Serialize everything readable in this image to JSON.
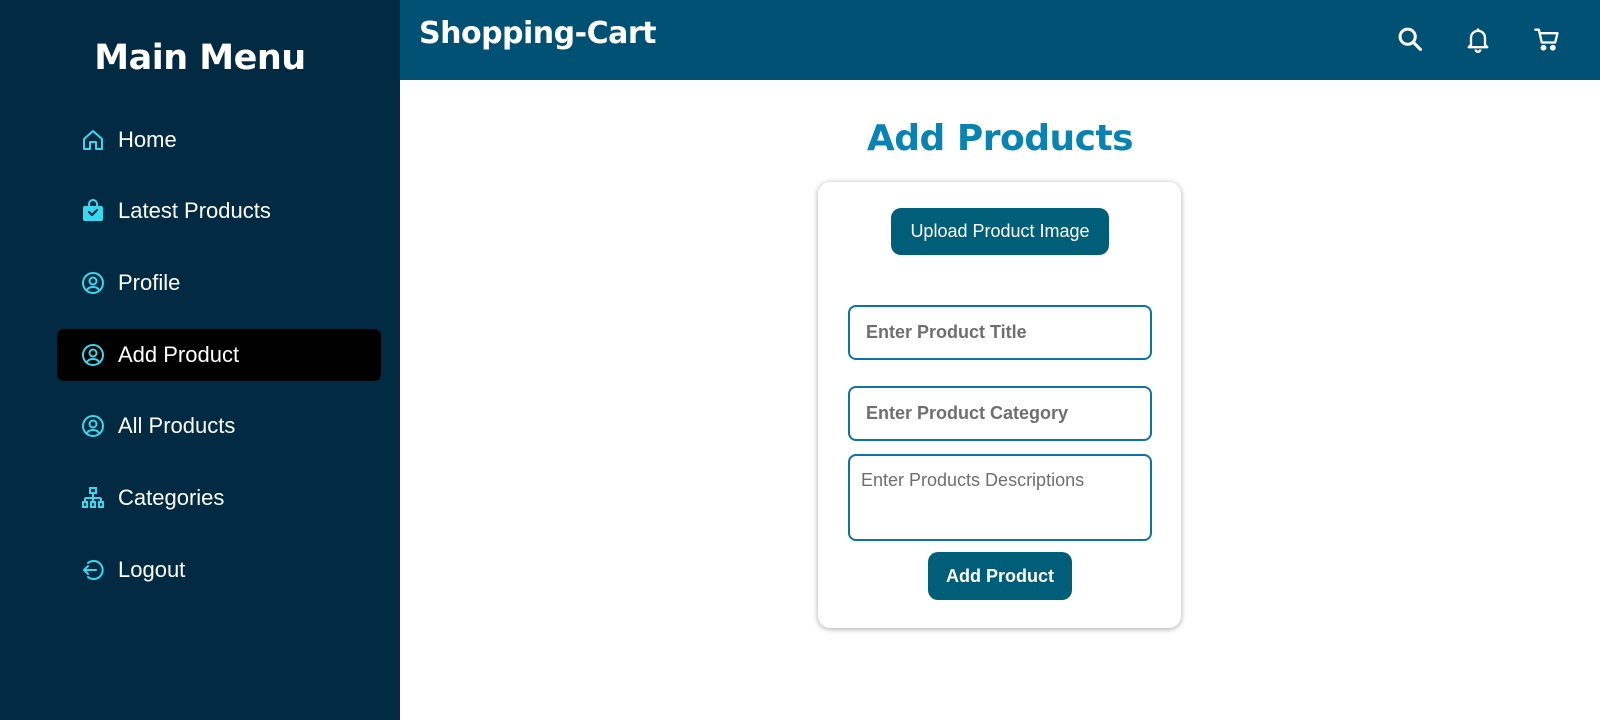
{
  "sidebar": {
    "title": "Main Menu",
    "items": [
      {
        "label": "Home",
        "icon": "home-icon"
      },
      {
        "label": "Latest Products",
        "icon": "shopping-bag-icon"
      },
      {
        "label": "Profile",
        "icon": "user-circle-icon"
      },
      {
        "label": "Add Product",
        "icon": "user-circle-icon",
        "active": true
      },
      {
        "label": "All Products",
        "icon": "user-circle-icon"
      },
      {
        "label": "Categories",
        "icon": "sitemap-icon"
      },
      {
        "label": "Logout",
        "icon": "logout-icon"
      }
    ]
  },
  "header": {
    "title": "Shopping-Cart",
    "icons": [
      "search-icon",
      "bell-icon",
      "cart-icon"
    ]
  },
  "main": {
    "heading": "Add Products",
    "form": {
      "upload_label": "Upload Product Image",
      "title_placeholder": "Enter Product Title",
      "category_placeholder": "Enter Product Category",
      "description_placeholder": "Enter Products Descriptions",
      "submit_label": "Add Product"
    }
  },
  "colors": {
    "sidebar_bg": "#022a43",
    "header_bg": "#015174",
    "accent_icon": "#38d8ee",
    "heading": "#0883b2",
    "button_bg": "#015e78",
    "field_border": "#0a74a6",
    "active_item_bg": "#000000"
  }
}
